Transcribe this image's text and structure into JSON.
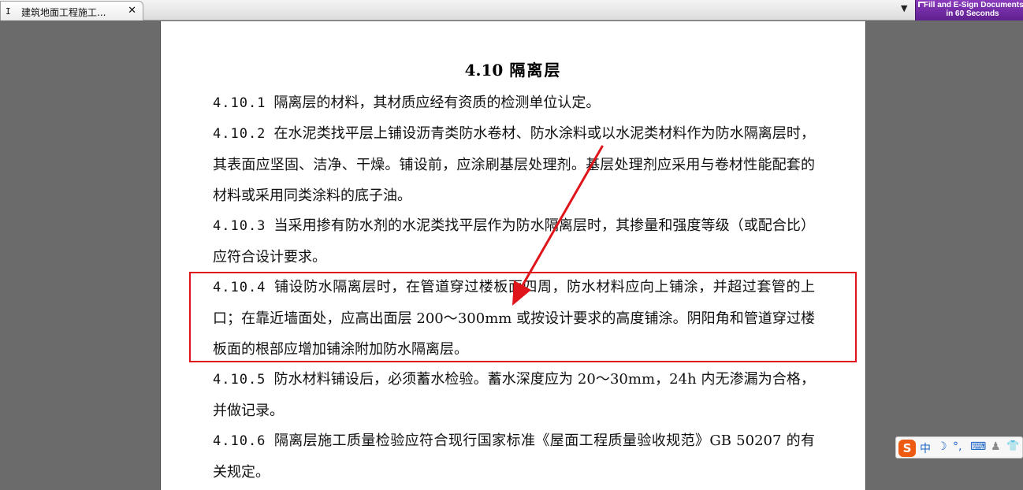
{
  "tab": {
    "icon_glyph": "I",
    "title": "建筑地面工程施工...",
    "close_glyph": "✕"
  },
  "dropdown_glyph": "▼",
  "promo": {
    "line1": "Fill and E-Sign Documents",
    "line2": "in 60 Seconds"
  },
  "document": {
    "section_number": "4.10",
    "section_title": "隔离层",
    "paragraphs": [
      {
        "clause": "4.10.1",
        "text": "隔离层的材料，其材质应经有资质的检测单位认定。"
      },
      {
        "clause": "4.10.2",
        "text": "在水泥类找平层上铺设沥青类防水卷材、防水涂料或以水泥类材料作为防水隔离层时，其表面应坚固、洁净、干燥。铺设前，应涂刷基层处理剂。基层处理剂应采用与卷材性能配套的材料或采用同类涂料的底子油。"
      },
      {
        "clause": "4.10.3",
        "text": "当采用掺有防水剂的水泥类找平层作为防水隔离层时，其掺量和强度等级（或配合比）应符合设计要求。"
      },
      {
        "clause": "4.10.4",
        "text": "铺设防水隔离层时，在管道穿过楼板面四周，防水材料应向上铺涂，并超过套管的上口；在靠近墙面处，应高出面层 200～300mm 或按设计要求的高度铺涂。阴阳角和管道穿过楼板面的根部应增加铺涂附加防水隔离层。"
      },
      {
        "clause": "4.10.5",
        "text": "防水材料铺设后，必须蓄水检验。蓄水深度应为 20～30mm，24h 内无渗漏为合格，并做记录。"
      },
      {
        "clause": "4.10.6",
        "text": "隔离层施工质量检验应符合现行国家标准《屋面工程质量验收规范》GB 50207 的有关规定。"
      }
    ]
  },
  "annotation_color": "#e0141b",
  "ime": {
    "logo": "S",
    "mode": "中",
    "moon_icon": "☽",
    "punct": "°,",
    "keyboard_icon": "⌨",
    "user_icon": "♟",
    "shirt_icon": "👕"
  }
}
